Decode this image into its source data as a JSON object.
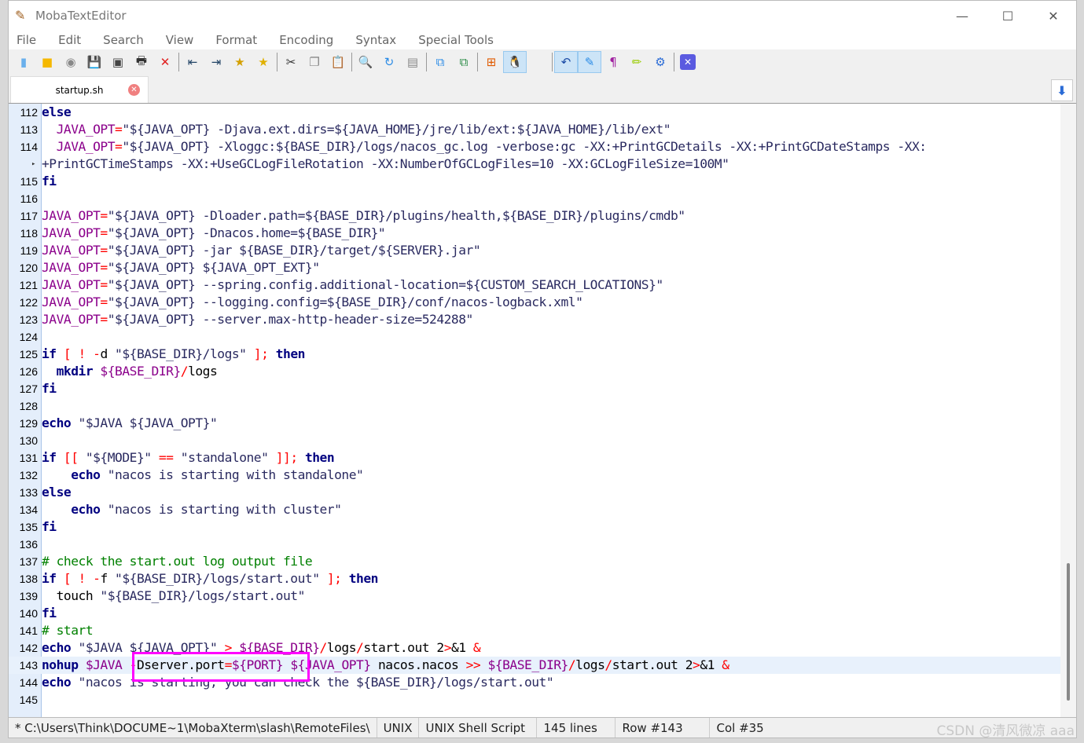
{
  "app": {
    "title": "MobaTextEditor",
    "icon": "notepad-pencil-icon"
  },
  "window_controls": [
    {
      "name": "minimize",
      "glyph": "—"
    },
    {
      "name": "maximize",
      "glyph": "☐"
    },
    {
      "name": "close",
      "glyph": "✕"
    }
  ],
  "menu": [
    "File",
    "Edit",
    "Search",
    "View",
    "Format",
    "Encoding",
    "Syntax",
    "Special Tools"
  ],
  "toolbar": [
    {
      "icon": "new-file-icon",
      "glyph": "▮",
      "color": "#6ab0ec"
    },
    {
      "icon": "open-folder-icon",
      "glyph": "■",
      "color": "#f5b800"
    },
    {
      "icon": "reload-icon",
      "glyph": "◉",
      "color": "#888"
    },
    {
      "icon": "save-icon",
      "glyph": "💾",
      "color": "#333"
    },
    {
      "icon": "save-as-icon",
      "glyph": "▣",
      "color": "#444"
    },
    {
      "icon": "print-icon",
      "glyph": "🖶",
      "color": "#333"
    },
    {
      "icon": "close-file-icon",
      "glyph": "✕",
      "color": "#e02020"
    },
    {
      "sep": true
    },
    {
      "icon": "outdent-icon",
      "glyph": "⇤",
      "color": "#246"
    },
    {
      "icon": "indent-icon",
      "glyph": "⇥",
      "color": "#246"
    },
    {
      "icon": "bookmark-star-icon",
      "glyph": "★",
      "color": "#d4a000"
    },
    {
      "icon": "bookmark-next-icon",
      "glyph": "★",
      "color": "#e0b000"
    },
    {
      "sep": true
    },
    {
      "icon": "cut-icon",
      "glyph": "✂",
      "color": "#333"
    },
    {
      "icon": "copy-icon",
      "glyph": "❐",
      "color": "#888"
    },
    {
      "icon": "paste-icon",
      "glyph": "📋",
      "color": "#6a8"
    },
    {
      "sep": true
    },
    {
      "icon": "search-icon",
      "glyph": "🔍",
      "color": "#2a6bd6"
    },
    {
      "icon": "replace-icon",
      "glyph": "↻",
      "color": "#2a8be6"
    },
    {
      "icon": "goto-icon",
      "glyph": "▤",
      "color": "#888"
    },
    {
      "sep": true
    },
    {
      "icon": "compare-icon",
      "glyph": "⧉",
      "color": "#2a8be6"
    },
    {
      "icon": "merge-icon",
      "glyph": "⧉",
      "color": "#2a8b46"
    },
    {
      "sep": true
    },
    {
      "icon": "windows-eol-icon",
      "glyph": "⊞",
      "color": "#e05a00"
    },
    {
      "icon": "linux-eol-icon",
      "glyph": "🐧",
      "color": "#000",
      "on": true
    },
    {
      "icon": "mac-eol-icon",
      "glyph": "",
      "color": "#2a8be6"
    },
    {
      "sep": true
    },
    {
      "icon": "undo-icon",
      "glyph": "↶",
      "color": "#1a4aa6",
      "on": true
    },
    {
      "icon": "edit-mode-icon",
      "glyph": "✎",
      "color": "#2a8be6",
      "on": true
    },
    {
      "icon": "pilcrow-icon",
      "glyph": "¶",
      "color": "#a020a0"
    },
    {
      "icon": "highlighter-icon",
      "glyph": "✏",
      "color": "#9c0"
    },
    {
      "icon": "settings-icon",
      "glyph": "⚙",
      "color": "#2a6bd6"
    },
    {
      "sep": true
    },
    {
      "icon": "exit-icon",
      "glyph": "✕",
      "color": "#fff",
      "bg": "#5a5ae0"
    }
  ],
  "tab": {
    "label": "startup.sh",
    "close_icon": "close-circle-icon"
  },
  "scroll_down_icon": "arrow-down-icon",
  "colors": {
    "keyword": "#000080",
    "variable": "#8b008b",
    "operator": "#ff0000",
    "comment": "#008000",
    "highlight_box": "#ff00ff",
    "current_line": "#e8f1fc"
  },
  "lines": [
    {
      "n": "112",
      "t": [
        [
          "k",
          "else"
        ]
      ]
    },
    {
      "n": "113",
      "t": [
        [
          "t",
          "  "
        ],
        [
          "v",
          "JAVA_OPT"
        ],
        [
          "o",
          "="
        ],
        [
          "s",
          "\"${JAVA_OPT} -Djava.ext.dirs=${JAVA_HOME}/jre/lib/ext:${JAVA_HOME}/lib/ext\""
        ]
      ]
    },
    {
      "n": "114",
      "t": [
        [
          "t",
          "  "
        ],
        [
          "v",
          "JAVA_OPT"
        ],
        [
          "o",
          "="
        ],
        [
          "s",
          "\"${JAVA_OPT} -Xloggc:${BASE_DIR}/logs/nacos_gc.log -verbose:gc -XX:+PrintGCDetails -XX:+PrintGCDateStamps -XX:"
        ]
      ]
    },
    {
      "n": "",
      "wrap": true,
      "t": [
        [
          "s",
          "+PrintGCTimeStamps -XX:+UseGCLogFileRotation -XX:NumberOfGCLogFiles=10 -XX:GCLogFileSize=100M\""
        ]
      ]
    },
    {
      "n": "115",
      "t": [
        [
          "k",
          "fi"
        ]
      ]
    },
    {
      "n": "116",
      "t": []
    },
    {
      "n": "117",
      "t": [
        [
          "v",
          "JAVA_OPT"
        ],
        [
          "o",
          "="
        ],
        [
          "s",
          "\"${JAVA_OPT} -Dloader.path=${BASE_DIR}/plugins/health,${BASE_DIR}/plugins/cmdb\""
        ]
      ]
    },
    {
      "n": "118",
      "t": [
        [
          "v",
          "JAVA_OPT"
        ],
        [
          "o",
          "="
        ],
        [
          "s",
          "\"${JAVA_OPT} -Dnacos.home=${BASE_DIR}\""
        ]
      ]
    },
    {
      "n": "119",
      "t": [
        [
          "v",
          "JAVA_OPT"
        ],
        [
          "o",
          "="
        ],
        [
          "s",
          "\"${JAVA_OPT} -jar ${BASE_DIR}/target/${SERVER}.jar\""
        ]
      ]
    },
    {
      "n": "120",
      "t": [
        [
          "v",
          "JAVA_OPT"
        ],
        [
          "o",
          "="
        ],
        [
          "s",
          "\"${JAVA_OPT} ${JAVA_OPT_EXT}\""
        ]
      ]
    },
    {
      "n": "121",
      "t": [
        [
          "v",
          "JAVA_OPT"
        ],
        [
          "o",
          "="
        ],
        [
          "s",
          "\"${JAVA_OPT} --spring.config.additional-location=${CUSTOM_SEARCH_LOCATIONS}\""
        ]
      ]
    },
    {
      "n": "122",
      "t": [
        [
          "v",
          "JAVA_OPT"
        ],
        [
          "o",
          "="
        ],
        [
          "s",
          "\"${JAVA_OPT} --logging.config=${BASE_DIR}/conf/nacos-logback.xml\""
        ]
      ]
    },
    {
      "n": "123",
      "t": [
        [
          "v",
          "JAVA_OPT"
        ],
        [
          "o",
          "="
        ],
        [
          "s",
          "\"${JAVA_OPT} --server.max-http-header-size=524288\""
        ]
      ]
    },
    {
      "n": "124",
      "t": []
    },
    {
      "n": "125",
      "t": [
        [
          "k",
          "if"
        ],
        [
          "o",
          " [ ! -"
        ],
        [
          "t",
          "d "
        ],
        [
          "s",
          "\"${BASE_DIR}/logs\""
        ],
        [
          "o",
          " ];"
        ],
        [
          "k",
          " then"
        ]
      ]
    },
    {
      "n": "126",
      "t": [
        [
          "t",
          "  "
        ],
        [
          "k",
          "mkdir"
        ],
        [
          "v",
          " ${BASE_DIR}"
        ],
        [
          "o",
          "/"
        ],
        [
          "t",
          "logs"
        ]
      ]
    },
    {
      "n": "127",
      "t": [
        [
          "k",
          "fi"
        ]
      ]
    },
    {
      "n": "128",
      "t": []
    },
    {
      "n": "129",
      "t": [
        [
          "k",
          "echo"
        ],
        [
          "s",
          " \"$JAVA ${JAVA_OPT}\""
        ]
      ]
    },
    {
      "n": "130",
      "t": []
    },
    {
      "n": "131",
      "t": [
        [
          "k",
          "if"
        ],
        [
          "o",
          " [[ "
        ],
        [
          "s",
          "\"${MODE}\""
        ],
        [
          "o",
          " == "
        ],
        [
          "s",
          "\"standalone\""
        ],
        [
          "o",
          " ]];"
        ],
        [
          "k",
          " then"
        ]
      ]
    },
    {
      "n": "132",
      "t": [
        [
          "t",
          "    "
        ],
        [
          "k",
          "echo"
        ],
        [
          "s",
          " \"nacos is starting with standalone\""
        ]
      ]
    },
    {
      "n": "133",
      "t": [
        [
          "k",
          "else"
        ]
      ]
    },
    {
      "n": "134",
      "t": [
        [
          "t",
          "    "
        ],
        [
          "k",
          "echo"
        ],
        [
          "s",
          " \"nacos is starting with cluster\""
        ]
      ]
    },
    {
      "n": "135",
      "t": [
        [
          "k",
          "fi"
        ]
      ]
    },
    {
      "n": "136",
      "t": []
    },
    {
      "n": "137",
      "t": [
        [
          "c",
          "# check the start.out log output file"
        ]
      ]
    },
    {
      "n": "138",
      "t": [
        [
          "k",
          "if"
        ],
        [
          "o",
          " [ ! -"
        ],
        [
          "t",
          "f "
        ],
        [
          "s",
          "\"${BASE_DIR}/logs/start.out\""
        ],
        [
          "o",
          " ];"
        ],
        [
          "k",
          " then"
        ]
      ]
    },
    {
      "n": "139",
      "t": [
        [
          "t",
          "  touch "
        ],
        [
          "s",
          "\"${BASE_DIR}/logs/start.out\""
        ]
      ]
    },
    {
      "n": "140",
      "t": [
        [
          "k",
          "fi"
        ]
      ]
    },
    {
      "n": "141",
      "t": [
        [
          "c",
          "# start"
        ]
      ]
    },
    {
      "n": "142",
      "t": [
        [
          "k",
          "echo"
        ],
        [
          "s",
          " \"$JAVA ${JAVA_OPT}\""
        ],
        [
          "o",
          " > "
        ],
        [
          "v",
          "${BASE_DIR}"
        ],
        [
          "o",
          "/"
        ],
        [
          "t",
          "logs"
        ],
        [
          "o",
          "/"
        ],
        [
          "t",
          "start.out 2"
        ],
        [
          "o",
          ">"
        ],
        [
          "t",
          "&1 "
        ],
        [
          "o",
          "&"
        ]
      ]
    },
    {
      "n": "143",
      "cur": true,
      "t": [
        [
          "k",
          "nohup"
        ],
        [
          "v",
          " $JAVA "
        ],
        [
          "o",
          "-"
        ],
        [
          "t",
          "Dserver.port"
        ],
        [
          "o",
          "="
        ],
        [
          "v",
          "${PORT}"
        ],
        [
          "v",
          " ${JAVA_OPT}"
        ],
        [
          "t",
          " nacos.nacos "
        ],
        [
          "o",
          ">>"
        ],
        [
          "v",
          " ${BASE_DIR}"
        ],
        [
          "o",
          "/"
        ],
        [
          "t",
          "logs"
        ],
        [
          "o",
          "/"
        ],
        [
          "t",
          "start.out 2"
        ],
        [
          "o",
          ">"
        ],
        [
          "t",
          "&1 "
        ],
        [
          "o",
          "&"
        ]
      ]
    },
    {
      "n": "144",
      "t": [
        [
          "k",
          "echo"
        ],
        [
          "s",
          " \"nacos is starting, you can check the ${BASE_DIR}/logs/start.out\""
        ]
      ]
    },
    {
      "n": "145",
      "t": []
    }
  ],
  "status": {
    "path": "* C:\\Users\\Think\\DOCUME~1\\MobaXterm\\slash\\RemoteFiles\\",
    "eol": "UNIX",
    "syntax": "UNIX Shell Script",
    "lines": "145 lines",
    "row": "Row #143",
    "col": "Col #35"
  },
  "watermark": "CSDN @清风微凉 aaa"
}
